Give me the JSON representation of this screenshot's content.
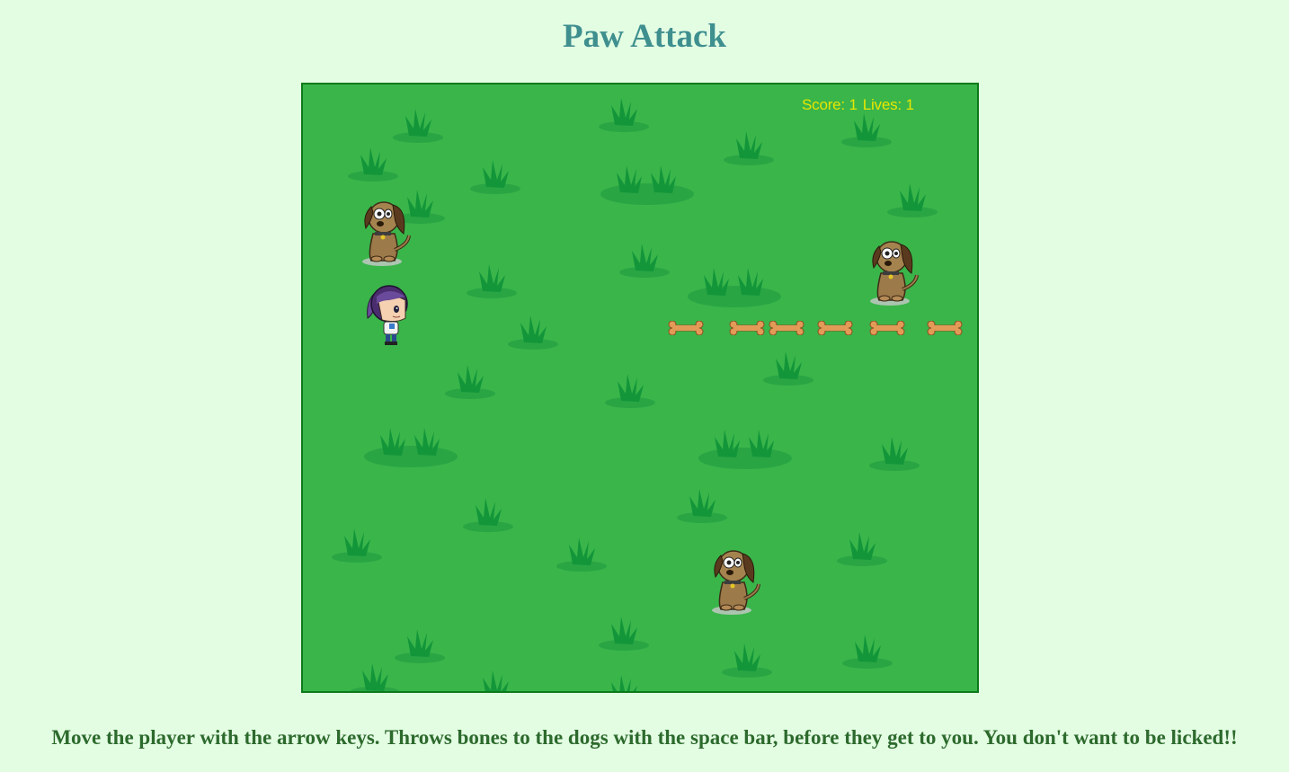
{
  "page": {
    "title": "Paw Attack",
    "instructions": "Move the player with the arrow keys. Throws bones to the dogs with the space bar, before they get to you. You don't want to be licked!!"
  },
  "hud": {
    "score_label": "Score: 1",
    "lives_label": "Lives: 1",
    "score": 1,
    "lives": 1
  },
  "colors": {
    "background": "#e3fde3",
    "grass": "#3ab54a",
    "grass_tuft": "#13963a",
    "canvas_border": "#0c7a1a",
    "hud_text": "#e6e600",
    "title": "#3f8f8f",
    "instructions": "#2d6a2d"
  },
  "sprites": {
    "player": "girl-player-icon",
    "enemy": "dog-enemy-icon",
    "projectile": "bone-icon"
  }
}
